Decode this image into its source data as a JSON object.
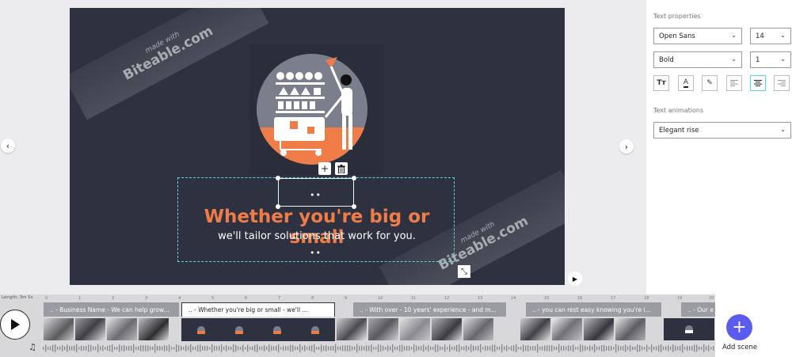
{
  "canvas": {
    "watermark_small": "made with",
    "watermark_brand": "Biteable.com",
    "headline": "Whether you're big or small",
    "subheadline": "we'll tailor solutions that work for you.",
    "handle_dots": "••"
  },
  "stage": {
    "prev_arrow": "‹",
    "next_arrow": "›",
    "add_glyph": "+",
    "expand_glyph": "⤡",
    "play_glyph": "▶"
  },
  "properties": {
    "text_heading": "Text properties",
    "font_family": "Open Sans",
    "font_size": "14",
    "font_weight": "Bold",
    "line_height": "1",
    "animations_heading": "Text animations",
    "animation": "Elegant rise",
    "chevron": "⌄",
    "tools": {
      "text_case": "Tт",
      "text_color": "A",
      "highlight": "✎",
      "align_left": "left",
      "align_center": "center",
      "align_right": "right"
    }
  },
  "timeline": {
    "length_label": "Length: 3m 5s",
    "ticks": [
      "0",
      "1",
      "2",
      "3",
      "4",
      "5",
      "6",
      "7",
      "8",
      "9",
      "10",
      "11",
      "12",
      "13",
      "14",
      "15",
      "16",
      "17",
      "18",
      "19",
      "20"
    ],
    "scenes": [
      {
        "label": ".. - Business Name - We can help grow..."
      },
      {
        "label": ".. - Whether you're big or small - we'll ..."
      },
      {
        "label": ".. - With over - 10 years' experience - and m..."
      },
      {
        "label": ".. - you can rest easy knowing you're i..."
      },
      {
        "label": ".. - Our e"
      }
    ],
    "add_scene_label": "Add scene",
    "add_glyph": "+",
    "music_glyph": "♫"
  },
  "colors": {
    "canvas_bg": "#2e3140",
    "headline": "#f07c47",
    "selection": "#5fd4d4",
    "add_scene": "#5b5bf0"
  }
}
